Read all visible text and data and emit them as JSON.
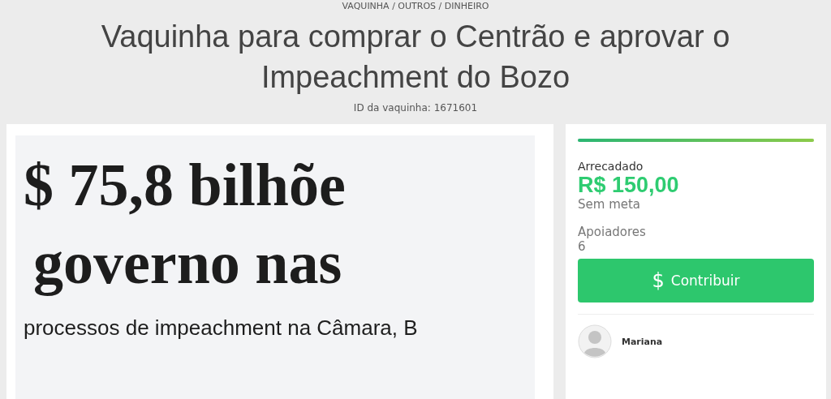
{
  "breadcrumb": "VAQUINHA / OUTROS / DINHEIRO",
  "title": "Vaquinha para comprar o Centrão e aprovar o Impeachment do Bozo",
  "campaign_id": "ID da vaquinha: 1671601",
  "cover_image": {
    "lines": [
      "$ 75,8 bilhõe",
      "governo nas",
      "processos de impeachment na Câmara, B"
    ]
  },
  "summary": {
    "progress": {
      "level": 1
    },
    "raised_label": "Arrecadado",
    "raised_amount": "R$ 150,00",
    "goal": "Sem meta",
    "supporters_label": "Apoiadores",
    "supporters_count": "6",
    "contribute_button": {
      "icon": "$",
      "label": "Contribuir"
    },
    "supporters": [
      {
        "name": "Mariana"
      }
    ]
  }
}
